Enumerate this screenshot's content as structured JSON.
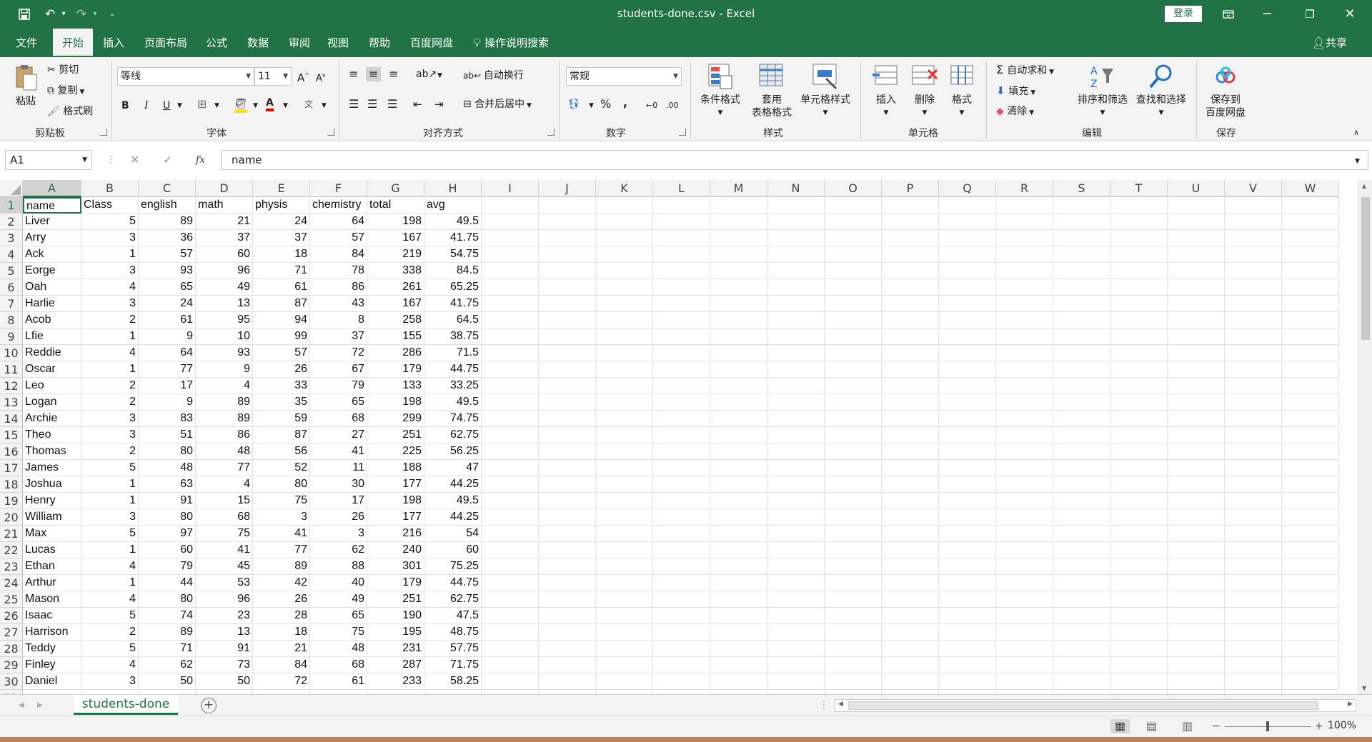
{
  "window": {
    "title": "students-done.csv  -  Excel",
    "login_label": "登录"
  },
  "menu": {
    "tabs": [
      "文件",
      "开始",
      "插入",
      "页面布局",
      "公式",
      "数据",
      "审阅",
      "视图",
      "帮助",
      "百度网盘"
    ],
    "active_tab": "开始",
    "search_label": "操作说明搜索",
    "share_label": "共享"
  },
  "ribbon": {
    "clipboard": {
      "paste": "粘贴",
      "cut": "剪切",
      "copy": "复制",
      "format_painter": "格式刷",
      "label": "剪贴板"
    },
    "font": {
      "name": "等线",
      "size": "11",
      "bold": "B",
      "italic": "I",
      "underline": "U",
      "label": "字体"
    },
    "alignment": {
      "wrap": "自动换行",
      "merge": "合并后居中",
      "label": "对齐方式"
    },
    "number": {
      "format": "常规",
      "percent": "%",
      "comma": ",",
      "label": "数字"
    },
    "styles": {
      "conditional": "条件格式",
      "table_line1": "套用",
      "table_line2": "表格格式",
      "cell_styles": "单元格样式",
      "label": "样式"
    },
    "cells": {
      "insert": "插入",
      "delete": "删除",
      "format": "格式",
      "label": "单元格"
    },
    "editing": {
      "autosum": "自动求和",
      "fill": "填充",
      "clear": "清除",
      "sort": "排序和筛选",
      "find": "查找和选择",
      "label": "编辑"
    },
    "save": {
      "line1": "保存到",
      "line2": "百度网盘",
      "label": "保存"
    }
  },
  "formula_bar": {
    "name_box": "A1",
    "fx": "fx",
    "content": "name"
  },
  "sheet": {
    "columns": [
      "A",
      "B",
      "C",
      "D",
      "E",
      "F",
      "G",
      "H",
      "I",
      "J",
      "K",
      "L",
      "M",
      "N",
      "O",
      "P",
      "Q",
      "R",
      "S",
      "T",
      "U",
      "V",
      "W"
    ],
    "headers": [
      "name",
      "Class",
      "english",
      "math",
      "physis",
      "chemistry",
      "total",
      "avg"
    ],
    "rows": [
      [
        "Liver",
        "5",
        "89",
        "21",
        "24",
        "64",
        "198",
        "49.5"
      ],
      [
        "Arry",
        "3",
        "36",
        "37",
        "37",
        "57",
        "167",
        "41.75"
      ],
      [
        "Ack",
        "1",
        "57",
        "60",
        "18",
        "84",
        "219",
        "54.75"
      ],
      [
        "Eorge",
        "3",
        "93",
        "96",
        "71",
        "78",
        "338",
        "84.5"
      ],
      [
        "Oah",
        "4",
        "65",
        "49",
        "61",
        "86",
        "261",
        "65.25"
      ],
      [
        "Harlie",
        "3",
        "24",
        "13",
        "87",
        "43",
        "167",
        "41.75"
      ],
      [
        "Acob",
        "2",
        "61",
        "95",
        "94",
        "8",
        "258",
        "64.5"
      ],
      [
        "Lfie",
        "1",
        "9",
        "10",
        "99",
        "37",
        "155",
        "38.75"
      ],
      [
        "Reddie",
        "4",
        "64",
        "93",
        "57",
        "72",
        "286",
        "71.5"
      ],
      [
        "Oscar",
        "1",
        "77",
        "9",
        "26",
        "67",
        "179",
        "44.75"
      ],
      [
        "Leo",
        "2",
        "17",
        "4",
        "33",
        "79",
        "133",
        "33.25"
      ],
      [
        "Logan",
        "2",
        "9",
        "89",
        "35",
        "65",
        "198",
        "49.5"
      ],
      [
        "Archie",
        "3",
        "83",
        "89",
        "59",
        "68",
        "299",
        "74.75"
      ],
      [
        "Theo",
        "3",
        "51",
        "86",
        "87",
        "27",
        "251",
        "62.75"
      ],
      [
        "Thomas",
        "2",
        "80",
        "48",
        "56",
        "41",
        "225",
        "56.25"
      ],
      [
        "James",
        "5",
        "48",
        "77",
        "52",
        "11",
        "188",
        "47"
      ],
      [
        "Joshua",
        "1",
        "63",
        "4",
        "80",
        "30",
        "177",
        "44.25"
      ],
      [
        "Henry",
        "1",
        "91",
        "15",
        "75",
        "17",
        "198",
        "49.5"
      ],
      [
        "William",
        "3",
        "80",
        "68",
        "3",
        "26",
        "177",
        "44.25"
      ],
      [
        "Max",
        "5",
        "97",
        "75",
        "41",
        "3",
        "216",
        "54"
      ],
      [
        "Lucas",
        "1",
        "60",
        "41",
        "77",
        "62",
        "240",
        "60"
      ],
      [
        "Ethan",
        "4",
        "79",
        "45",
        "89",
        "88",
        "301",
        "75.25"
      ],
      [
        "Arthur",
        "1",
        "44",
        "53",
        "42",
        "40",
        "179",
        "44.75"
      ],
      [
        "Mason",
        "4",
        "80",
        "96",
        "26",
        "49",
        "251",
        "62.75"
      ],
      [
        "Isaac",
        "5",
        "74",
        "23",
        "28",
        "65",
        "190",
        "47.5"
      ],
      [
        "Harrison",
        "2",
        "89",
        "13",
        "18",
        "75",
        "195",
        "48.75"
      ],
      [
        "Teddy",
        "5",
        "71",
        "91",
        "21",
        "48",
        "231",
        "57.75"
      ],
      [
        "Finley",
        "4",
        "62",
        "73",
        "84",
        "68",
        "287",
        "71.75"
      ],
      [
        "Daniel",
        "3",
        "50",
        "50",
        "72",
        "61",
        "233",
        "58.25"
      ]
    ],
    "tab_name": "students-done"
  },
  "status": {
    "zoom": "100%"
  },
  "colors": {
    "accent": "#217346"
  }
}
